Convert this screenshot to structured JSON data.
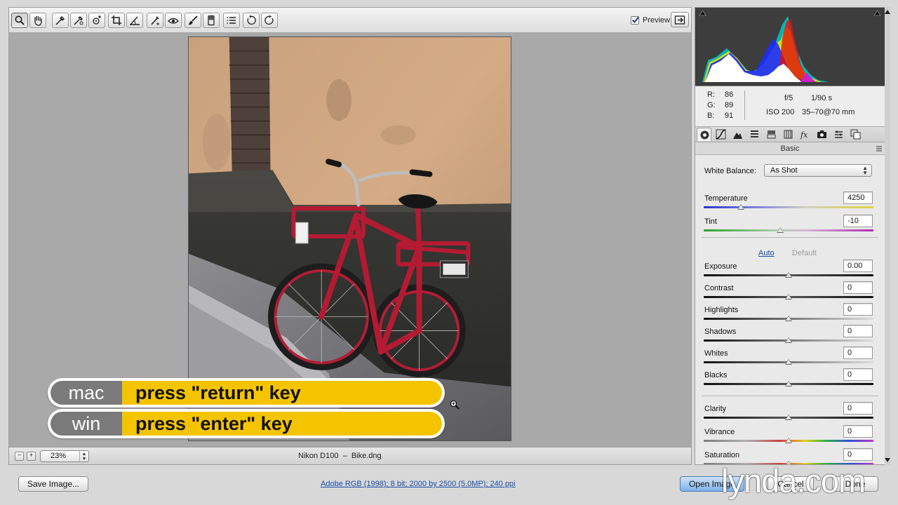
{
  "toolbar": {
    "tools": [
      "zoom-tool",
      "hand-tool",
      "white-balance-tool",
      "color-sampler-tool",
      "targeted-adjustment-tool",
      "crop-tool",
      "straighten-tool",
      "spot-removal-tool",
      "red-eye-removal-tool",
      "adjustment-brush-tool",
      "graduated-filter-tool",
      "preferences",
      "rotate-left",
      "rotate-right"
    ],
    "preview_label": "Preview",
    "preview_checked": true
  },
  "status": {
    "zoom_out": "−",
    "zoom_in": "+",
    "zoom_value": "23%",
    "camera_file": "Nikon D100  –  Bike.dng"
  },
  "histogram": {
    "rgb": {
      "r_label": "R:",
      "r": "86",
      "g_label": "G:",
      "g": "89",
      "b_label": "B:",
      "b": "91"
    },
    "camera": {
      "aperture": "f/5",
      "shutter": "1/90 s",
      "iso": "ISO 200",
      "lens": "35–70@70 mm"
    }
  },
  "panel": {
    "title": "Basic",
    "tabs": [
      "basic-tab",
      "tone-curve-tab",
      "detail-tab",
      "hsl-tab",
      "split-toning-tab",
      "lens-corrections-tab",
      "effects-tab",
      "camera-calibration-tab",
      "presets-tab",
      "snapshots-tab"
    ],
    "white_balance_label": "White Balance:",
    "white_balance_value": "As Shot",
    "auto_label": "Auto",
    "default_label": "Default",
    "sliders_wb": [
      {
        "name": "temperature",
        "label": "Temperature",
        "value": "4250",
        "position": 0.22
      },
      {
        "name": "tint",
        "label": "Tint",
        "value": "-10",
        "position": 0.45
      }
    ],
    "sliders_tone": [
      {
        "name": "exposure",
        "label": "Exposure",
        "value": "0.00",
        "position": 0.5
      },
      {
        "name": "contrast",
        "label": "Contrast",
        "value": "0",
        "position": 0.5
      },
      {
        "name": "highlights",
        "label": "Highlights",
        "value": "0",
        "position": 0.5
      },
      {
        "name": "shadows",
        "label": "Shadows",
        "value": "0",
        "position": 0.5
      },
      {
        "name": "whites",
        "label": "Whites",
        "value": "0",
        "position": 0.5
      },
      {
        "name": "blacks",
        "label": "Blacks",
        "value": "0",
        "position": 0.5
      }
    ],
    "sliders_presence": [
      {
        "name": "clarity",
        "label": "Clarity",
        "value": "0",
        "position": 0.5
      },
      {
        "name": "vibrance",
        "label": "Vibrance",
        "value": "0",
        "position": 0.5
      },
      {
        "name": "saturation",
        "label": "Saturation",
        "value": "0",
        "position": 0.5
      }
    ]
  },
  "bottom": {
    "save_image": "Save Image...",
    "workflow": "Adobe RGB (1998); 8 bit; 2000 by 2500 (5.0MP); 240 ppi",
    "open_image": "Open Image",
    "cancel": "Cancel",
    "done": "Done"
  },
  "overlay": {
    "mac_label": "mac",
    "mac_action": "press \"return\" key",
    "win_label": "win",
    "win_action": "press \"enter\" key",
    "logo": "lynda.com"
  },
  "colors": {
    "accent_yellow": "#f5c400",
    "os_gray": "#7a7a7a",
    "link_blue": "#1a4fa8"
  }
}
